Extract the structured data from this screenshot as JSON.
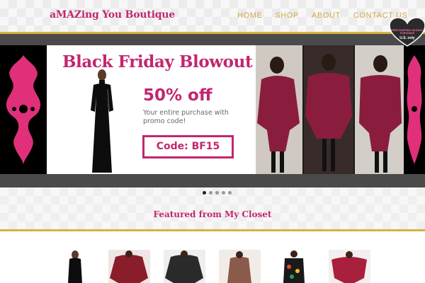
{
  "header": {
    "logo": "aMAZing You Boutique",
    "nav": [
      "HOME",
      "SHOP",
      "ABOUT",
      "CONTACT US"
    ],
    "badge": {
      "line1": "FREE SHIPPING ON $100+ PURCHASE",
      "line2": "U.S. only"
    }
  },
  "slider": {
    "title": "Black Friday Blowout",
    "percent": "50% off",
    "description": "Your entire purchase with promo code!",
    "code": "Code: BF15",
    "dots": 5,
    "active_dot": 0
  },
  "featured": {
    "title": "Featured from My Closet"
  },
  "colors": {
    "brand_pink": "#c2266f",
    "gold": "#d8b23e",
    "nav_gold": "#d0a84a"
  }
}
